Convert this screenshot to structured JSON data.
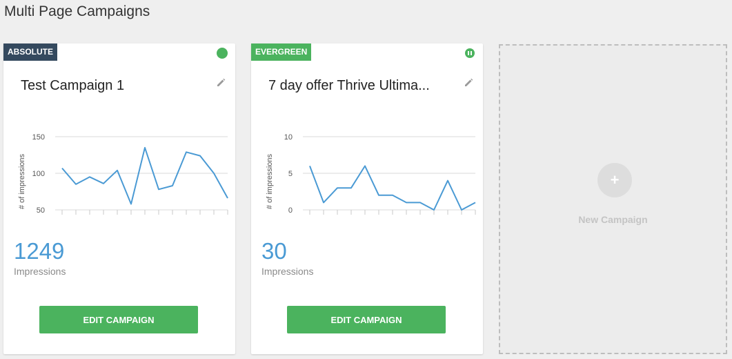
{
  "page": {
    "title": "Multi Page Campaigns"
  },
  "colors": {
    "accent": "#4bb35e",
    "absolute_badge": "#34495e",
    "line": "#4a9ad4"
  },
  "campaigns": [
    {
      "type_label": "ABSOLUTE",
      "status": "active",
      "name": "Test Campaign 1",
      "impressions_count": "1249",
      "impressions_label": "Impressions",
      "edit_label": "EDIT CAMPAIGN",
      "chart_data": {
        "type": "line",
        "ylabel": "# of impressions",
        "yticks": [
          "150",
          "100",
          "50"
        ],
        "ylim": [
          50,
          150
        ],
        "values": [
          107,
          85,
          95,
          86,
          104,
          58,
          135,
          78,
          83,
          129,
          124,
          100,
          66
        ]
      }
    },
    {
      "type_label": "EVERGREEN",
      "status": "paused",
      "name": "7 day offer Thrive Ultima...",
      "impressions_count": "30",
      "impressions_label": "Impressions",
      "edit_label": "EDIT CAMPAIGN",
      "chart_data": {
        "type": "line",
        "ylabel": "# of impressions",
        "yticks": [
          "10",
          "5",
          "0"
        ],
        "ylim": [
          0,
          10
        ],
        "values": [
          6,
          1,
          3,
          3,
          6,
          2,
          2,
          1,
          1,
          0,
          4,
          0,
          1
        ]
      }
    }
  ],
  "new_campaign": {
    "label": "New Campaign",
    "icon": "plus-icon",
    "glyph": "+"
  }
}
